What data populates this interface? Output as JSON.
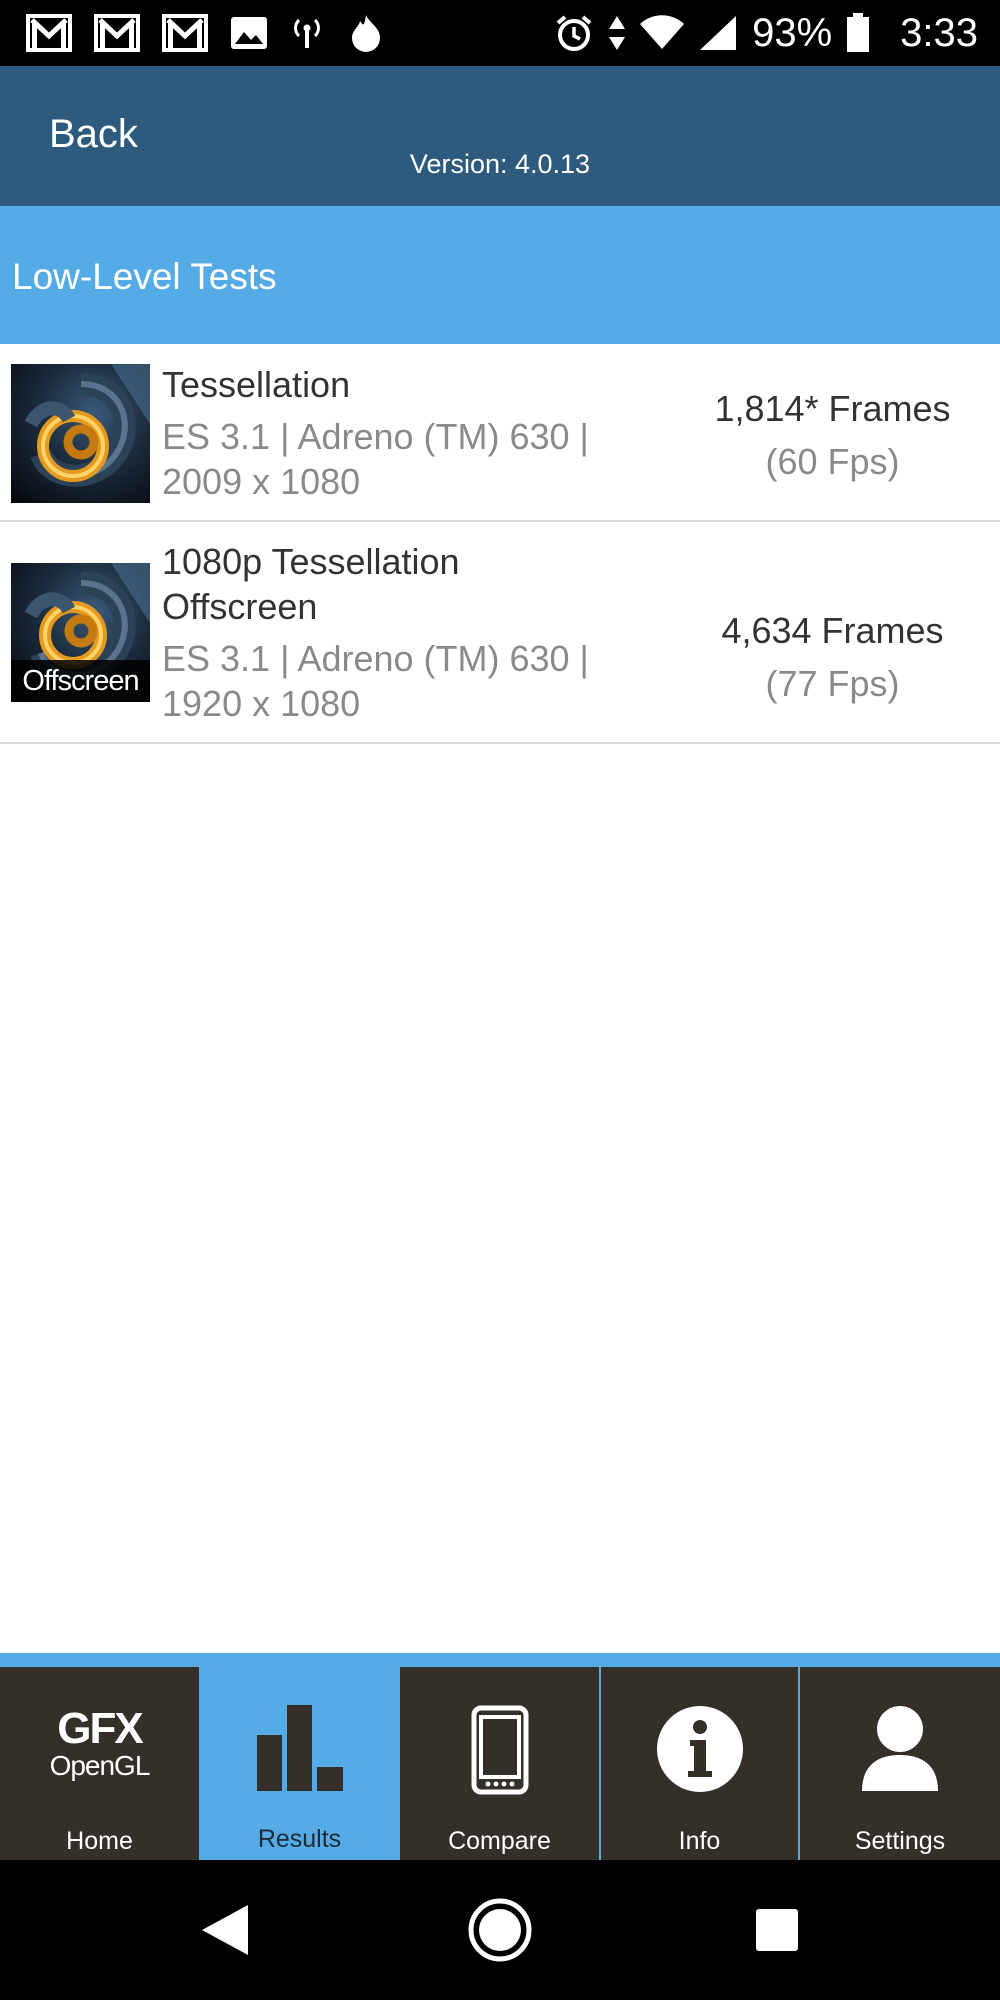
{
  "status_bar": {
    "battery_percent": "93%",
    "time": "3:33",
    "left_icons": [
      "gmail-icon",
      "gmail-icon",
      "gmail-icon",
      "image-icon",
      "hotspot-icon",
      "flame-icon"
    ],
    "right_icons": [
      "alarm-icon",
      "data-arrows-icon",
      "wifi-icon",
      "signal-icon",
      "battery-icon"
    ]
  },
  "header": {
    "back_label": "Back",
    "version": "Version: 4.0.13"
  },
  "section": {
    "title": "Low-Level Tests"
  },
  "results": [
    {
      "title": "Tessellation",
      "detail_line1": "ES 3.1 | Adreno (TM) 630 |",
      "detail_line2": "2009 x 1080",
      "frames": "1,814* Frames",
      "fps": "(60 Fps)",
      "thumb_label": ""
    },
    {
      "title_line1": "1080p Tessellation",
      "title_line2": "Offscreen",
      "detail_line1": "ES 3.1 | Adreno (TM) 630 |",
      "detail_line2": "1920 x 1080",
      "frames": "4,634 Frames",
      "fps": "(77 Fps)",
      "thumb_label": "Offscreen"
    }
  ],
  "bottom_nav": {
    "logo_top": "GFX",
    "logo_bottom": "OpenGL",
    "tabs": [
      {
        "label": "Home",
        "icon": "gfx-logo-icon",
        "active": false
      },
      {
        "label": "Results",
        "icon": "bar-chart-icon",
        "active": true
      },
      {
        "label": "Compare",
        "icon": "phone-icon",
        "active": false
      },
      {
        "label": "Info",
        "icon": "info-icon",
        "active": false
      },
      {
        "label": "Settings",
        "icon": "user-icon",
        "active": false
      }
    ]
  },
  "colors": {
    "header": "#2d5a7d",
    "accent": "#55abe5",
    "nav_tab": "#342f29"
  }
}
